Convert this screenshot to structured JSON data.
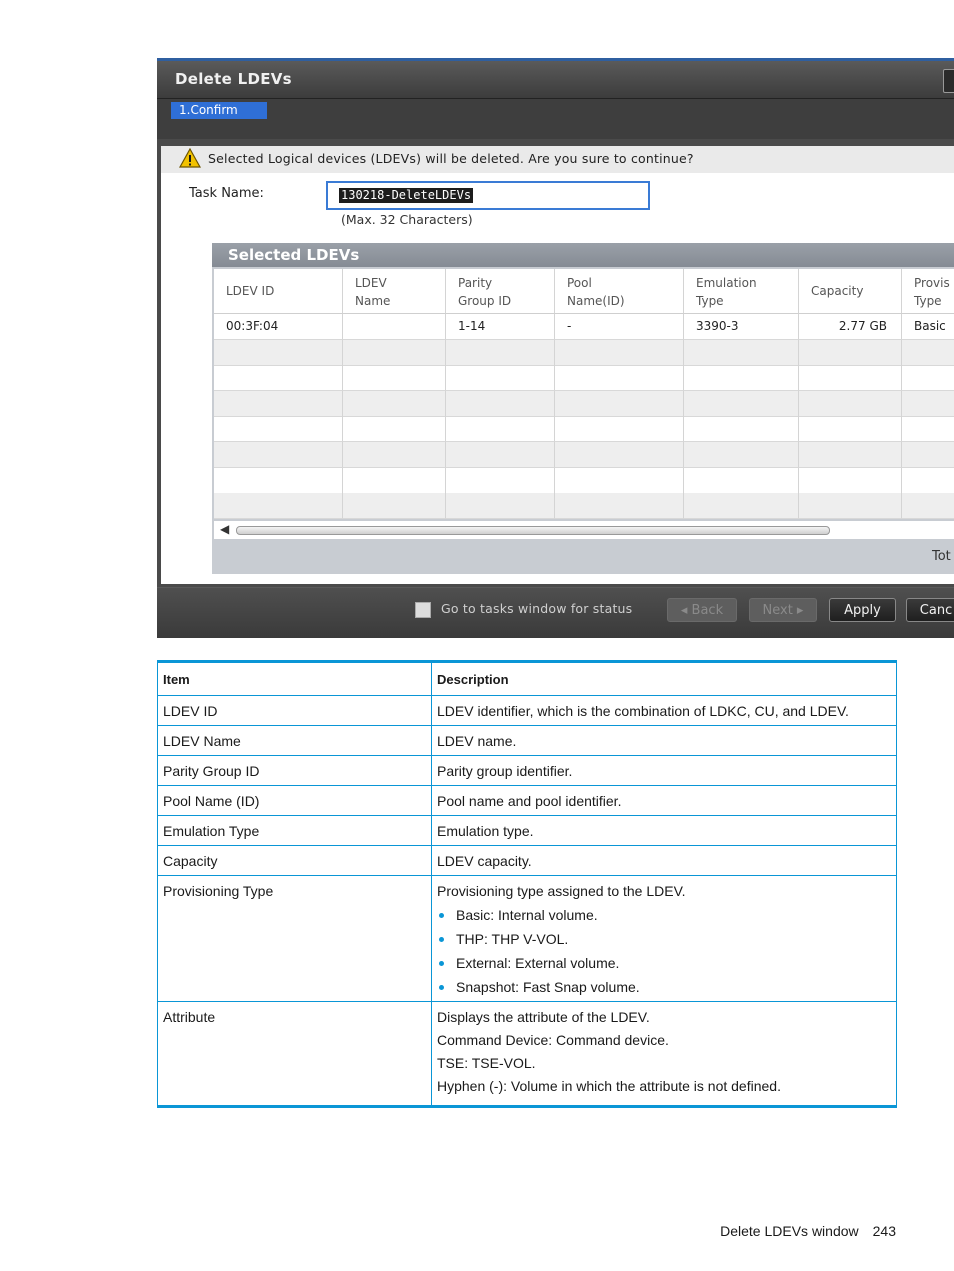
{
  "window": {
    "title": "Delete LDEVs",
    "step_label": "1.Confirm",
    "warning": "Selected Logical devices (LDEVs) will be deleted. Are you sure to continue?",
    "task_name_label": "Task Name:",
    "task_name_value": "130218-DeleteLDEVs",
    "task_name_hint": "(Max. 32 Characters)",
    "panel_title": "Selected LDEVs",
    "columns": [
      {
        "line1": "LDEV ID",
        "line2": ""
      },
      {
        "line1": "LDEV",
        "line2": "Name"
      },
      {
        "line1": "Parity",
        "line2": "Group ID"
      },
      {
        "line1": "Pool",
        "line2": "Name(ID)"
      },
      {
        "line1": "Emulation",
        "line2": "Type"
      },
      {
        "line1": "Capacity",
        "line2": ""
      },
      {
        "line1": "Provis",
        "line2": "Type"
      }
    ],
    "rows": [
      [
        "00:3F:04",
        "",
        "1-14",
        "-",
        "3390-3",
        "2.77 GB",
        "Basic"
      ]
    ],
    "total_label": "Tot",
    "checkbox_label": "Go to tasks window for status",
    "buttons": {
      "back": "◂ Back",
      "next": "Next ▸",
      "apply": "Apply",
      "cancel": "Canc"
    }
  },
  "table": {
    "header_item": "Item",
    "header_desc": "Description",
    "rows": [
      {
        "item": "LDEV ID",
        "desc": "LDEV identifier, which is the combination of LDKC, CU, and LDEV."
      },
      {
        "item": "LDEV Name",
        "desc": "LDEV name."
      },
      {
        "item": "Parity Group ID",
        "desc": "Parity group identifier."
      },
      {
        "item": "Pool Name (ID)",
        "desc": "Pool name and pool identifier."
      },
      {
        "item": "Emulation Type",
        "desc": "Emulation type."
      },
      {
        "item": "Capacity",
        "desc": "LDEV capacity."
      }
    ],
    "prov": {
      "item": "Provisioning Type",
      "desc": "Provisioning type assigned to the LDEV.",
      "bullets": [
        "Basic: Internal volume.",
        "THP: THP V-VOL.",
        "External: External volume.",
        "Snapshot: Fast Snap volume."
      ]
    },
    "attr": {
      "item": "Attribute",
      "lines": [
        "Displays the attribute of the LDEV.",
        "Command Device: Command device.",
        "TSE: TSE-VOL.",
        "Hyphen (-): Volume in which the attribute is not defined."
      ]
    }
  },
  "footer": {
    "section": "Delete LDEVs window",
    "page": "243"
  },
  "colors": {
    "accent": "#0a96d6",
    "step": "#2f6fd6",
    "input_focus": "#3a7bd5"
  }
}
